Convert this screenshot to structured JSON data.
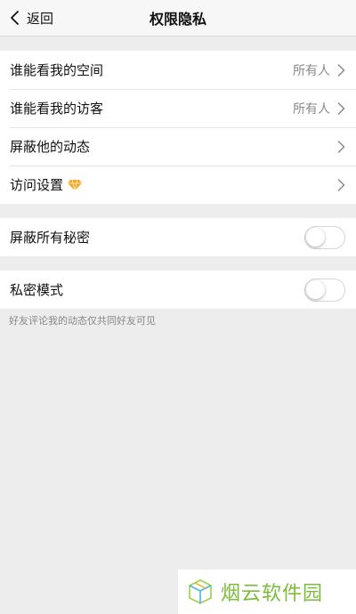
{
  "header": {
    "back_label": "返回",
    "title": "权限隐私"
  },
  "group1": {
    "items": [
      {
        "label": "谁能看我的空间",
        "value": "所有人"
      },
      {
        "label": "谁能看我的访客",
        "value": "所有人"
      },
      {
        "label": "屏蔽他的动态"
      },
      {
        "label": "访问设置"
      }
    ]
  },
  "group2": {
    "label": "屏蔽所有秘密",
    "toggle_on": false
  },
  "group3": {
    "label": "私密模式",
    "toggle_on": false,
    "hint": "好友评论我的动态仅共同好友可见"
  },
  "watermark": {
    "text": "烟云软件园"
  },
  "colors": {
    "background": "#ededed",
    "card": "#ffffff",
    "secondary_text": "#8a8a8a",
    "watermark_green": "#7bbd3a",
    "vip_diamond": "#f5a623"
  },
  "icons": [
    "chevron-left-icon",
    "chevron-right-icon",
    "diamond-icon",
    "cube-logo-icon"
  ]
}
